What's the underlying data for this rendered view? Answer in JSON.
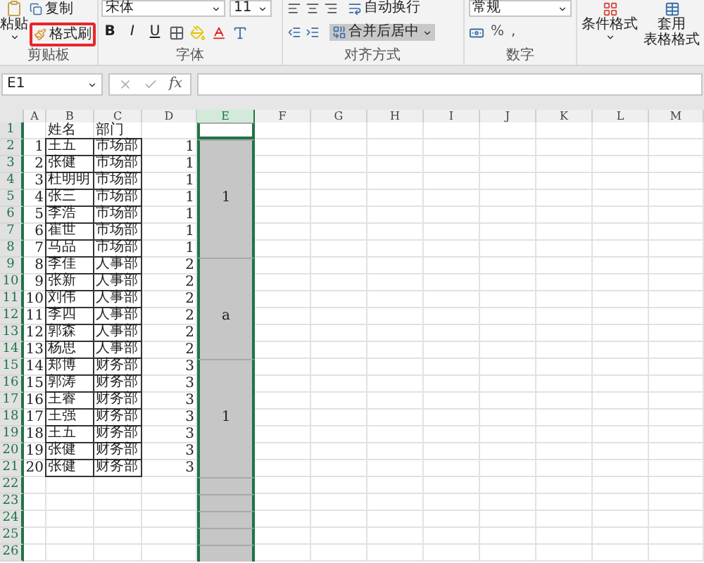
{
  "ribbon": {
    "clipboard": {
      "paste": "粘贴",
      "copy": "复制",
      "format_painter": {
        "label": "格式刷",
        "highlighted": true
      },
      "label": "剪贴板"
    },
    "font": {
      "name": "宋体",
      "size": "11",
      "styles": [
        "B",
        "I",
        "U"
      ],
      "label": "字体"
    },
    "alignment": {
      "wrap": "自动换行",
      "merge": {
        "label": "合并后居中",
        "selected": true
      },
      "label": "对齐方式"
    },
    "number": {
      "format": "常规",
      "symbols": [
        "%",
        ","
      ],
      "label": "数字"
    },
    "styles": {
      "conditional": "条件格式",
      "table_format": [
        "套用",
        "表格格式"
      ]
    }
  },
  "formula_bar": {
    "name_box": "E1",
    "fx": "fx"
  },
  "sheet": {
    "columns": [
      {
        "letter": "A",
        "selected": false
      },
      {
        "letter": "B",
        "selected": false
      },
      {
        "letter": "C",
        "selected": false
      },
      {
        "letter": "D",
        "selected": false
      },
      {
        "letter": "E",
        "selected": true
      },
      {
        "letter": "F",
        "selected": false
      },
      {
        "letter": "G",
        "selected": false
      },
      {
        "letter": "H",
        "selected": false
      },
      {
        "letter": "I",
        "selected": false
      },
      {
        "letter": "J",
        "selected": false
      },
      {
        "letter": "K",
        "selected": false
      },
      {
        "letter": "L",
        "selected": false
      },
      {
        "letter": "M",
        "selected": false
      }
    ],
    "row_numbers": [
      "1",
      "2",
      "3",
      "4",
      "5",
      "6",
      "7",
      "8",
      "9",
      "10",
      "11",
      "12",
      "13",
      "14",
      "15",
      "16",
      "17",
      "18",
      "19",
      "20",
      "21",
      "22",
      "23",
      "24",
      "25",
      "26"
    ],
    "rows": [
      {
        "a": "",
        "b": "姓名",
        "c": "部门",
        "d": "",
        "bordered": false
      },
      {
        "a": "1",
        "b": "王五",
        "c": "市场部",
        "d": "1",
        "bordered": true
      },
      {
        "a": "2",
        "b": "张健",
        "c": "市场部",
        "d": "1",
        "bordered": true
      },
      {
        "a": "3",
        "b": "杜明明",
        "c": "市场部",
        "d": "1",
        "bordered": true
      },
      {
        "a": "4",
        "b": "张三",
        "c": "市场部",
        "d": "1",
        "bordered": true
      },
      {
        "a": "5",
        "b": "李浩",
        "c": "市场部",
        "d": "1",
        "bordered": true
      },
      {
        "a": "6",
        "b": "崔世",
        "c": "市场部",
        "d": "1",
        "bordered": true
      },
      {
        "a": "7",
        "b": "马品",
        "c": "市场部",
        "d": "1",
        "bordered": true
      },
      {
        "a": "8",
        "b": "李佳",
        "c": "人事部",
        "d": "2",
        "bordered": true
      },
      {
        "a": "9",
        "b": "张新",
        "c": "人事部",
        "d": "2",
        "bordered": true
      },
      {
        "a": "10",
        "b": "刘伟",
        "c": "人事部",
        "d": "2",
        "bordered": true
      },
      {
        "a": "11",
        "b": "李四",
        "c": "人事部",
        "d": "2",
        "bordered": true
      },
      {
        "a": "12",
        "b": "郭森",
        "c": "人事部",
        "d": "2",
        "bordered": true
      },
      {
        "a": "13",
        "b": "杨思",
        "c": "人事部",
        "d": "2",
        "bordered": true
      },
      {
        "a": "14",
        "b": "郑博",
        "c": "财务部",
        "d": "3",
        "bordered": true
      },
      {
        "a": "15",
        "b": "郭涛",
        "c": "财务部",
        "d": "3",
        "bordered": true
      },
      {
        "a": "16",
        "b": "王睿",
        "c": "财务部",
        "d": "3",
        "bordered": true
      },
      {
        "a": "17",
        "b": "王强",
        "c": "财务部",
        "d": "3",
        "bordered": true
      },
      {
        "a": "18",
        "b": "王五",
        "c": "财务部",
        "d": "3",
        "bordered": true
      },
      {
        "a": "19",
        "b": "张健",
        "c": "财务部",
        "d": "3",
        "bordered": true
      },
      {
        "a": "20",
        "b": "张健",
        "c": "财务部",
        "d": "3",
        "bordered": true
      }
    ],
    "e_column": [
      {
        "active": true,
        "merged_up": false
      },
      {
        "text": "1",
        "active": false,
        "merged_up": false
      },
      {
        "active": false,
        "merged_up": true
      },
      {
        "active": false,
        "merged_up": true
      },
      {
        "active": false,
        "merged_up": true
      },
      {
        "active": false,
        "merged_up": true
      },
      {
        "active": false,
        "merged_up": true
      },
      {
        "active": false,
        "merged_up": true
      },
      {
        "text": "a",
        "active": false,
        "merged_up": false
      },
      {
        "active": false,
        "merged_up": true
      },
      {
        "active": false,
        "merged_up": true
      },
      {
        "active": false,
        "merged_up": true
      },
      {
        "active": false,
        "merged_up": true
      },
      {
        "active": false,
        "merged_up": true
      },
      {
        "text": "1",
        "active": false,
        "merged_up": false
      },
      {
        "active": false,
        "merged_up": true
      },
      {
        "active": false,
        "merged_up": true
      },
      {
        "active": false,
        "merged_up": true
      },
      {
        "active": false,
        "merged_up": true
      },
      {
        "active": false,
        "merged_up": true
      },
      {
        "active": false,
        "merged_up": true
      },
      {
        "active": false,
        "merged_up": false
      },
      {
        "active": false,
        "merged_up": false
      },
      {
        "active": false,
        "merged_up": false
      },
      {
        "active": false,
        "merged_up": false
      },
      {
        "active": false,
        "merged_up": false
      }
    ]
  }
}
